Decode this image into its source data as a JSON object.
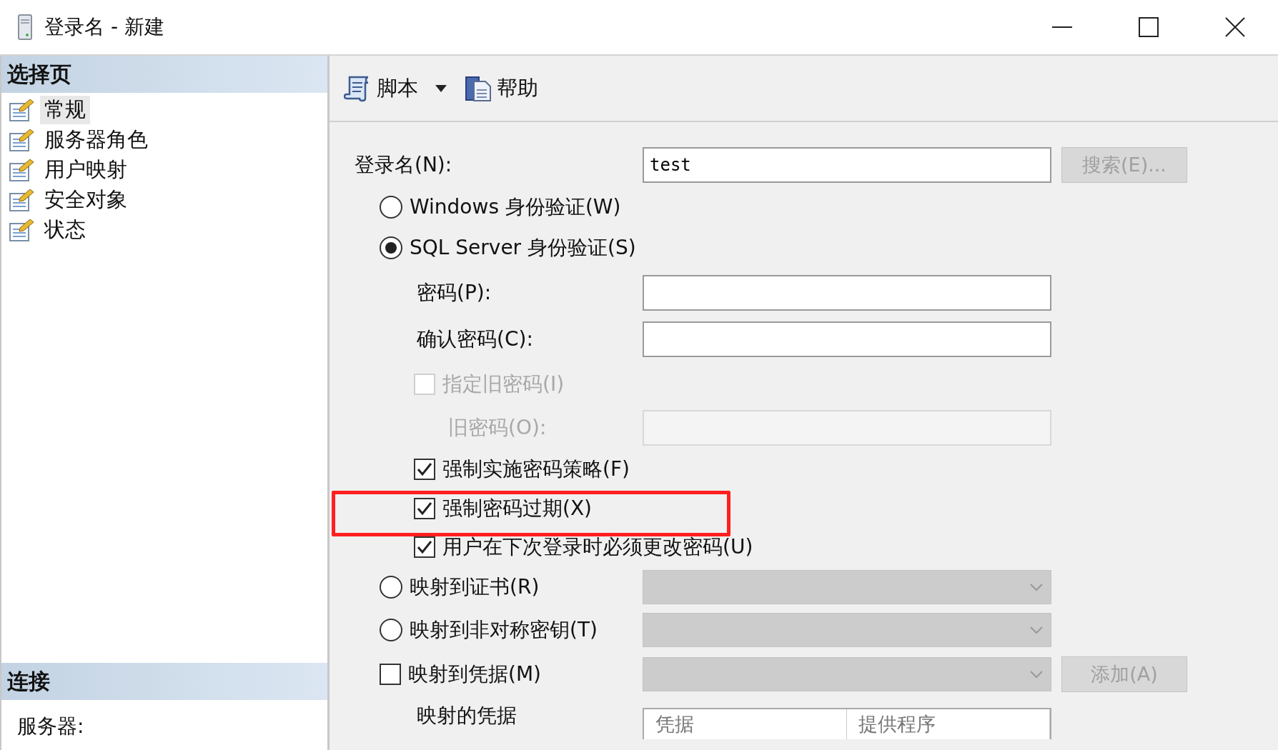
{
  "window": {
    "title": "登录名 - 新建"
  },
  "sidebar": {
    "header": "选择页",
    "items": [
      {
        "label": "常规",
        "selected": true
      },
      {
        "label": "服务器角色",
        "selected": false
      },
      {
        "label": "用户映射",
        "selected": false
      },
      {
        "label": "安全对象",
        "selected": false
      },
      {
        "label": "状态",
        "selected": false
      }
    ],
    "connection_header": "连接",
    "connection_items": [
      "服务器:"
    ]
  },
  "toolbar": {
    "items": [
      {
        "kind": "script",
        "label": "脚本",
        "dropdown": true
      },
      {
        "kind": "help",
        "label": "帮助",
        "dropdown": false
      }
    ]
  },
  "form": {
    "rows": [
      {
        "kind": "text",
        "label": "登录名(N):",
        "value": "test",
        "button": {
          "label": "搜索(E)...",
          "disabled": true
        }
      },
      {
        "kind": "radio",
        "label": "Windows 身份验证(W)",
        "selected": false
      },
      {
        "kind": "radio",
        "label": "SQL Server 身份验证(S)",
        "selected": true
      },
      {
        "kind": "password",
        "label": "密码(P):",
        "disabled": false
      },
      {
        "kind": "password",
        "label": "确认密码(C):",
        "disabled": false
      },
      {
        "kind": "checkbox",
        "label": "指定旧密码(I)",
        "checked": false,
        "disabled": true,
        "highlighted": false
      },
      {
        "kind": "subpassword",
        "label": "旧密码(O):",
        "disabled": true
      },
      {
        "kind": "checkbox",
        "label": "强制实施密码策略(F)",
        "checked": true,
        "disabled": false,
        "highlighted": false
      },
      {
        "kind": "checkbox",
        "label": "强制密码过期(X)",
        "checked": true,
        "disabled": false,
        "highlighted": true
      },
      {
        "kind": "checkbox",
        "label": "用户在下次登录时必须更改密码(U)",
        "checked": true,
        "disabled": false,
        "highlighted": false
      },
      {
        "kind": "radio-select",
        "label": "映射到证书(R)",
        "selected": false,
        "disabled": true
      },
      {
        "kind": "radio-select",
        "label": "映射到非对称密钥(T)",
        "selected": false,
        "disabled": true
      },
      {
        "kind": "check-select",
        "label": "映射到凭据(M)",
        "checked": false,
        "disabled": true,
        "button": {
          "label": "添加(A)",
          "disabled": true
        }
      },
      {
        "kind": "table",
        "label": "映射的凭据",
        "columns": [
          "凭据",
          "提供程序"
        ]
      }
    ]
  }
}
